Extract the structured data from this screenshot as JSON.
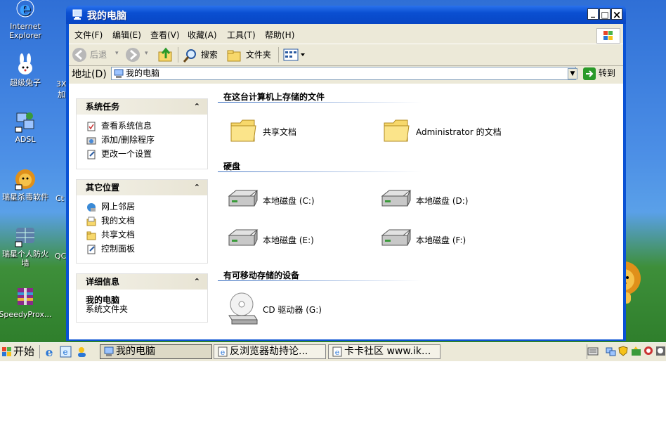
{
  "desktop": {
    "icons": [
      {
        "label": "Internet\nExplorer",
        "icon": "ie-icon"
      },
      {
        "label": "超级兔子",
        "icon": "rabbit-icon"
      },
      {
        "label": "ADSL",
        "icon": "network-icon"
      },
      {
        "label": "瑞星杀毒软件",
        "icon": "lion-icon"
      },
      {
        "label": "瑞星个人防火\n墙",
        "icon": "firewall-icon"
      },
      {
        "label": "SpeedyProx...",
        "icon": "archive-icon"
      }
    ],
    "partial_labels": [
      "3X",
      "加",
      "Ct",
      "QC"
    ]
  },
  "window": {
    "title": "我的电脑",
    "controls": {
      "minimize": "_",
      "maximize": "□",
      "close": "×"
    },
    "menu": [
      "文件(F)",
      "编辑(E)",
      "查看(V)",
      "收藏(A)",
      "工具(T)",
      "帮助(H)"
    ],
    "toolbar": {
      "back": "后退",
      "search": "搜索",
      "folders": "文件夹"
    },
    "address": {
      "label": "地址(D)",
      "value": "我的电脑",
      "go": "转到"
    }
  },
  "left_panels": {
    "system_tasks": {
      "title": "系统任务",
      "items": [
        "查看系统信息",
        "添加/删除程序",
        "更改一个设置"
      ]
    },
    "other_places": {
      "title": "其它位置",
      "items": [
        "网上邻居",
        "我的文档",
        "共享文档",
        "控制面板"
      ]
    },
    "details": {
      "title": "详细信息",
      "name": "我的电脑",
      "desc": "系统文件夹"
    }
  },
  "groups": {
    "files": {
      "title": "在这台计算机上存储的文件",
      "items": [
        "共享文档",
        "Administrator 的文档"
      ]
    },
    "drives": {
      "title": "硬盘",
      "items": [
        "本地磁盘 (C:)",
        "本地磁盘 (D:)",
        "本地磁盘 (E:)",
        "本地磁盘 (F:)"
      ]
    },
    "removable": {
      "title": "有可移动存储的设备",
      "items": [
        "CD 驱动器 (G:)"
      ]
    }
  },
  "taskbar": {
    "start": "开始",
    "tasks": [
      "我的电脑",
      "反浏览器劫持论...",
      "卡卡社区 www.ik..."
    ]
  },
  "colors": {
    "title_blue": "#0a52d4",
    "taskbar": "#ece9d8",
    "folder_yellow": "#f7d86b"
  }
}
